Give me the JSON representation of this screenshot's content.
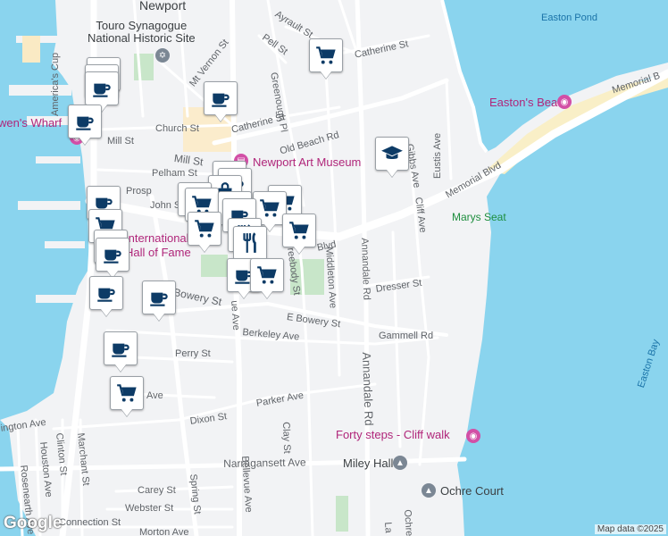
{
  "map": {
    "colors": {
      "water": "#8ad4ee",
      "land": "#f2f3f5",
      "road": "#ffffff",
      "park": "#c8e6c9",
      "beach": "#f9efc7",
      "pin_icon": "#0d3b66"
    },
    "places": {
      "newport": "Newport",
      "touro": "Touro Synagogue\nNational Historic Site",
      "easton_pond": "Easton Pond",
      "eastons_beach": "Easton's Beach",
      "bowens_wharf": "wen's Wharf",
      "art_museum": "Newport Art Museum",
      "marys_seat": "Marys Seat",
      "hall_of_fame": "International\nHall of Fame",
      "forty_steps": "Forty steps - Cliff walk",
      "miley_hall": "Miley Hall",
      "ochre_court": "Ochre Court",
      "easton_bay": "Easton Bay"
    },
    "streets": {
      "americas_cup": "America's Cup",
      "mt_vernon": "Mt Vernon St",
      "ayrault": "Ayrault St",
      "pell": "Pell St",
      "catherine_ne": "Catherine St",
      "catherine": "Catherine St",
      "greenough": "Greenough Pl",
      "old_beach": "Old Beach Rd",
      "church": "Church St",
      "mill": "Mill St",
      "mill2": "Mill St",
      "pelham": "Pelham St",
      "prosp": "Prosp",
      "john": "John S",
      "memorial_blvd": "Memorial Blvd",
      "memorial_b": "Memorial B",
      "blvd": "Blvd",
      "eustis": "Eustis Ave",
      "gibbs": "Gibbs Ave",
      "cliff": "Cliff Ave",
      "annandale": "Annandale Rd",
      "annandale2": "Annandale Rd",
      "middleton": "Middleton Ave",
      "freebody": "Freebody St",
      "dresser": "Dresser St",
      "bowery": "Bowery St",
      "e_bowery": "E Bowery St",
      "gammell": "Gammell Rd",
      "berkeley": "Berkeley Ave",
      "perry": "Perry St",
      "ave": "Ave",
      "parker": "Parker Ave",
      "dixon": "Dixon St",
      "bellevue": "Bellevue Ave",
      "ue_ave": "ue Ave",
      "spring": "Spring St",
      "clay": "Clay St",
      "narragansett": "Narragansett Ave",
      "carey": "Carey St",
      "webster": "Webster St",
      "connection": "Connection St",
      "morton": "Morton Ave",
      "ington": "ington Ave",
      "clinton": "Clinton St",
      "marchant": "Marchant St",
      "houston": "Houston Ave",
      "rosenearth": "Rosenearth Ave",
      "la": "La",
      "ochre": "Ochre"
    },
    "pins": [
      {
        "icon": "coffee-icon"
      },
      {
        "icon": "coffee-icon"
      },
      {
        "icon": "coffee-icon"
      },
      {
        "icon": "cart-icon"
      },
      {
        "icon": "coffee-icon"
      },
      {
        "icon": "graduation-cap-icon"
      },
      {
        "icon": "coffee-icon"
      },
      {
        "icon": "coffee-icon"
      },
      {
        "icon": "coffee-icon"
      },
      {
        "icon": "shopping-bag-icon"
      },
      {
        "icon": "cart-icon"
      },
      {
        "icon": "cart-icon"
      },
      {
        "icon": "cart-icon"
      },
      {
        "icon": "cart-icon"
      },
      {
        "icon": "coffee-icon"
      },
      {
        "icon": "shopping-bag-icon"
      },
      {
        "icon": "coffee-icon"
      },
      {
        "icon": "cart-icon"
      },
      {
        "icon": "cart-icon"
      },
      {
        "icon": "cart-icon"
      },
      {
        "icon": "restaurant-icon"
      },
      {
        "icon": "restaurant-icon"
      },
      {
        "icon": "coffee-icon"
      },
      {
        "icon": "coffee-icon"
      },
      {
        "icon": "coffee-icon"
      },
      {
        "icon": "cart-icon"
      }
    ],
    "attribution": "Map data ©2025",
    "logo": "Google"
  }
}
